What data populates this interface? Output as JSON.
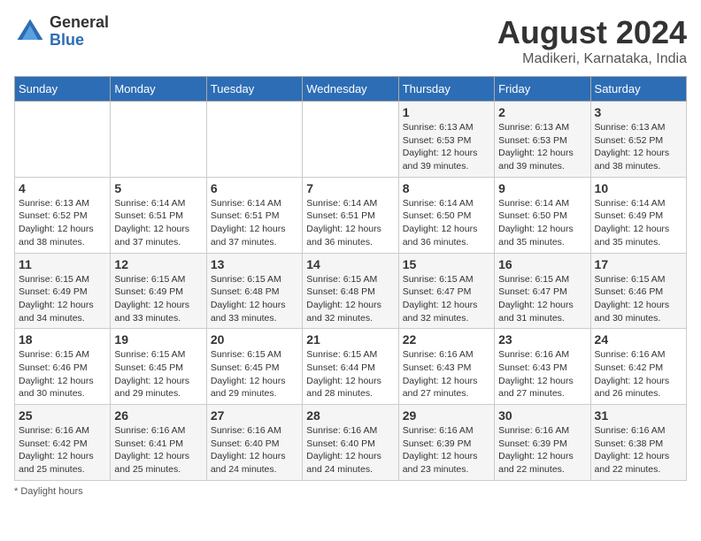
{
  "header": {
    "logo_line1": "General",
    "logo_line2": "Blue",
    "title": "August 2024",
    "subtitle": "Madikeri, Karnataka, India"
  },
  "days_of_week": [
    "Sunday",
    "Monday",
    "Tuesday",
    "Wednesday",
    "Thursday",
    "Friday",
    "Saturday"
  ],
  "weeks": [
    [
      {
        "day": "",
        "sunrise": "",
        "sunset": "",
        "daylight": ""
      },
      {
        "day": "",
        "sunrise": "",
        "sunset": "",
        "daylight": ""
      },
      {
        "day": "",
        "sunrise": "",
        "sunset": "",
        "daylight": ""
      },
      {
        "day": "",
        "sunrise": "",
        "sunset": "",
        "daylight": ""
      },
      {
        "day": "1",
        "sunrise": "Sunrise: 6:13 AM",
        "sunset": "Sunset: 6:53 PM",
        "daylight": "Daylight: 12 hours and 39 minutes."
      },
      {
        "day": "2",
        "sunrise": "Sunrise: 6:13 AM",
        "sunset": "Sunset: 6:53 PM",
        "daylight": "Daylight: 12 hours and 39 minutes."
      },
      {
        "day": "3",
        "sunrise": "Sunrise: 6:13 AM",
        "sunset": "Sunset: 6:52 PM",
        "daylight": "Daylight: 12 hours and 38 minutes."
      }
    ],
    [
      {
        "day": "4",
        "sunrise": "Sunrise: 6:13 AM",
        "sunset": "Sunset: 6:52 PM",
        "daylight": "Daylight: 12 hours and 38 minutes."
      },
      {
        "day": "5",
        "sunrise": "Sunrise: 6:14 AM",
        "sunset": "Sunset: 6:51 PM",
        "daylight": "Daylight: 12 hours and 37 minutes."
      },
      {
        "day": "6",
        "sunrise": "Sunrise: 6:14 AM",
        "sunset": "Sunset: 6:51 PM",
        "daylight": "Daylight: 12 hours and 37 minutes."
      },
      {
        "day": "7",
        "sunrise": "Sunrise: 6:14 AM",
        "sunset": "Sunset: 6:51 PM",
        "daylight": "Daylight: 12 hours and 36 minutes."
      },
      {
        "day": "8",
        "sunrise": "Sunrise: 6:14 AM",
        "sunset": "Sunset: 6:50 PM",
        "daylight": "Daylight: 12 hours and 36 minutes."
      },
      {
        "day": "9",
        "sunrise": "Sunrise: 6:14 AM",
        "sunset": "Sunset: 6:50 PM",
        "daylight": "Daylight: 12 hours and 35 minutes."
      },
      {
        "day": "10",
        "sunrise": "Sunrise: 6:14 AM",
        "sunset": "Sunset: 6:49 PM",
        "daylight": "Daylight: 12 hours and 35 minutes."
      }
    ],
    [
      {
        "day": "11",
        "sunrise": "Sunrise: 6:15 AM",
        "sunset": "Sunset: 6:49 PM",
        "daylight": "Daylight: 12 hours and 34 minutes."
      },
      {
        "day": "12",
        "sunrise": "Sunrise: 6:15 AM",
        "sunset": "Sunset: 6:49 PM",
        "daylight": "Daylight: 12 hours and 33 minutes."
      },
      {
        "day": "13",
        "sunrise": "Sunrise: 6:15 AM",
        "sunset": "Sunset: 6:48 PM",
        "daylight": "Daylight: 12 hours and 33 minutes."
      },
      {
        "day": "14",
        "sunrise": "Sunrise: 6:15 AM",
        "sunset": "Sunset: 6:48 PM",
        "daylight": "Daylight: 12 hours and 32 minutes."
      },
      {
        "day": "15",
        "sunrise": "Sunrise: 6:15 AM",
        "sunset": "Sunset: 6:47 PM",
        "daylight": "Daylight: 12 hours and 32 minutes."
      },
      {
        "day": "16",
        "sunrise": "Sunrise: 6:15 AM",
        "sunset": "Sunset: 6:47 PM",
        "daylight": "Daylight: 12 hours and 31 minutes."
      },
      {
        "day": "17",
        "sunrise": "Sunrise: 6:15 AM",
        "sunset": "Sunset: 6:46 PM",
        "daylight": "Daylight: 12 hours and 30 minutes."
      }
    ],
    [
      {
        "day": "18",
        "sunrise": "Sunrise: 6:15 AM",
        "sunset": "Sunset: 6:46 PM",
        "daylight": "Daylight: 12 hours and 30 minutes."
      },
      {
        "day": "19",
        "sunrise": "Sunrise: 6:15 AM",
        "sunset": "Sunset: 6:45 PM",
        "daylight": "Daylight: 12 hours and 29 minutes."
      },
      {
        "day": "20",
        "sunrise": "Sunrise: 6:15 AM",
        "sunset": "Sunset: 6:45 PM",
        "daylight": "Daylight: 12 hours and 29 minutes."
      },
      {
        "day": "21",
        "sunrise": "Sunrise: 6:15 AM",
        "sunset": "Sunset: 6:44 PM",
        "daylight": "Daylight: 12 hours and 28 minutes."
      },
      {
        "day": "22",
        "sunrise": "Sunrise: 6:16 AM",
        "sunset": "Sunset: 6:43 PM",
        "daylight": "Daylight: 12 hours and 27 minutes."
      },
      {
        "day": "23",
        "sunrise": "Sunrise: 6:16 AM",
        "sunset": "Sunset: 6:43 PM",
        "daylight": "Daylight: 12 hours and 27 minutes."
      },
      {
        "day": "24",
        "sunrise": "Sunrise: 6:16 AM",
        "sunset": "Sunset: 6:42 PM",
        "daylight": "Daylight: 12 hours and 26 minutes."
      }
    ],
    [
      {
        "day": "25",
        "sunrise": "Sunrise: 6:16 AM",
        "sunset": "Sunset: 6:42 PM",
        "daylight": "Daylight: 12 hours and 25 minutes."
      },
      {
        "day": "26",
        "sunrise": "Sunrise: 6:16 AM",
        "sunset": "Sunset: 6:41 PM",
        "daylight": "Daylight: 12 hours and 25 minutes."
      },
      {
        "day": "27",
        "sunrise": "Sunrise: 6:16 AM",
        "sunset": "Sunset: 6:40 PM",
        "daylight": "Daylight: 12 hours and 24 minutes."
      },
      {
        "day": "28",
        "sunrise": "Sunrise: 6:16 AM",
        "sunset": "Sunset: 6:40 PM",
        "daylight": "Daylight: 12 hours and 24 minutes."
      },
      {
        "day": "29",
        "sunrise": "Sunrise: 6:16 AM",
        "sunset": "Sunset: 6:39 PM",
        "daylight": "Daylight: 12 hours and 23 minutes."
      },
      {
        "day": "30",
        "sunrise": "Sunrise: 6:16 AM",
        "sunset": "Sunset: 6:39 PM",
        "daylight": "Daylight: 12 hours and 22 minutes."
      },
      {
        "day": "31",
        "sunrise": "Sunrise: 6:16 AM",
        "sunset": "Sunset: 6:38 PM",
        "daylight": "Daylight: 12 hours and 22 minutes."
      }
    ]
  ],
  "footer": {
    "note": "Daylight hours"
  }
}
